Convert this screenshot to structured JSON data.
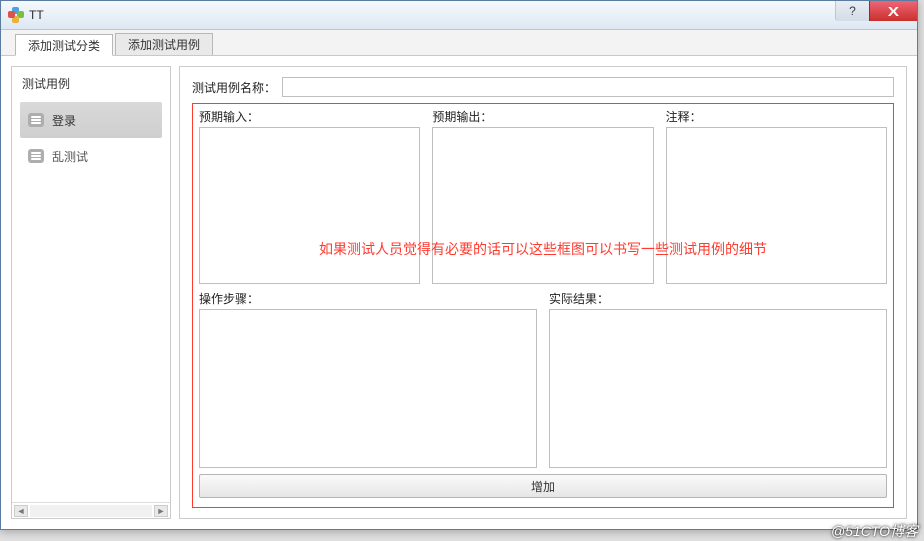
{
  "window": {
    "title": "TT"
  },
  "titlebar_buttons": {
    "help": "?",
    "close": "X"
  },
  "tabs": [
    {
      "label": "添加测试分类",
      "active": true
    },
    {
      "label": "添加测试用例",
      "active": false
    }
  ],
  "sidebar": {
    "title": "测试用例",
    "items": [
      {
        "label": "登录",
        "selected": true
      },
      {
        "label": "乱测试",
        "selected": false
      }
    ]
  },
  "form": {
    "name_label": "测试用例名称：",
    "name_value": "",
    "expected_input_label": "预期输入：",
    "expected_output_label": "预期输出：",
    "comment_label": "注释：",
    "steps_label": "操作步骤：",
    "actual_result_label": "实际结果：",
    "add_button": "增加"
  },
  "annotation": "如果测试人员觉得有必要的话可以这些框图可以书写一些测试用例的细节",
  "watermark": "@51CTO博客",
  "colors": {
    "highlight_border": "#ff3a2f"
  }
}
